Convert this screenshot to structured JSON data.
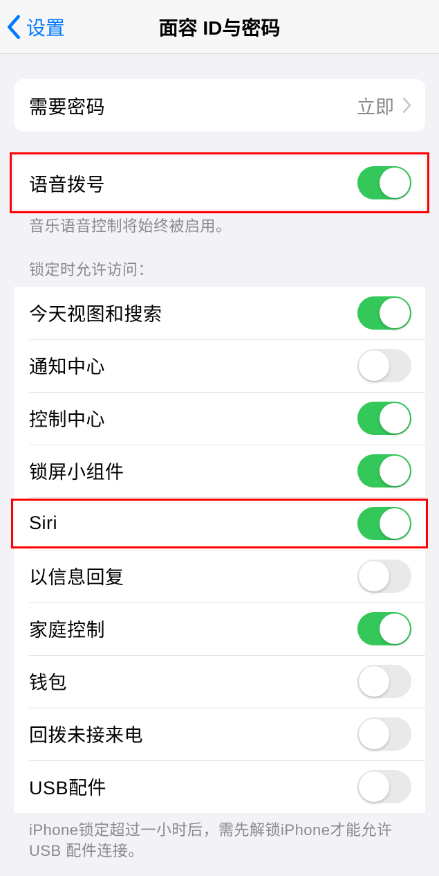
{
  "nav": {
    "back": "设置",
    "title": "面容 ID与密码"
  },
  "require_passcode": {
    "label": "需要密码",
    "value": "立即"
  },
  "voice_dial": {
    "label": "语音拨号",
    "footer": "音乐语音控制将始终被启用。"
  },
  "lock_access": {
    "header": "锁定时允许访问：",
    "items": [
      {
        "label": "今天视图和搜索",
        "on": true
      },
      {
        "label": "通知中心",
        "on": false
      },
      {
        "label": "控制中心",
        "on": true
      },
      {
        "label": "锁屏小组件",
        "on": true
      },
      {
        "label": "Siri",
        "on": true
      },
      {
        "label": "以信息回复",
        "on": false
      },
      {
        "label": "家庭控制",
        "on": true
      },
      {
        "label": "钱包",
        "on": false
      },
      {
        "label": "回拨未接来电",
        "on": false
      },
      {
        "label": "USB配件",
        "on": false
      }
    ],
    "footer": "iPhone锁定超过一小时后，需先解锁iPhone才能允许USB 配件连接。"
  }
}
